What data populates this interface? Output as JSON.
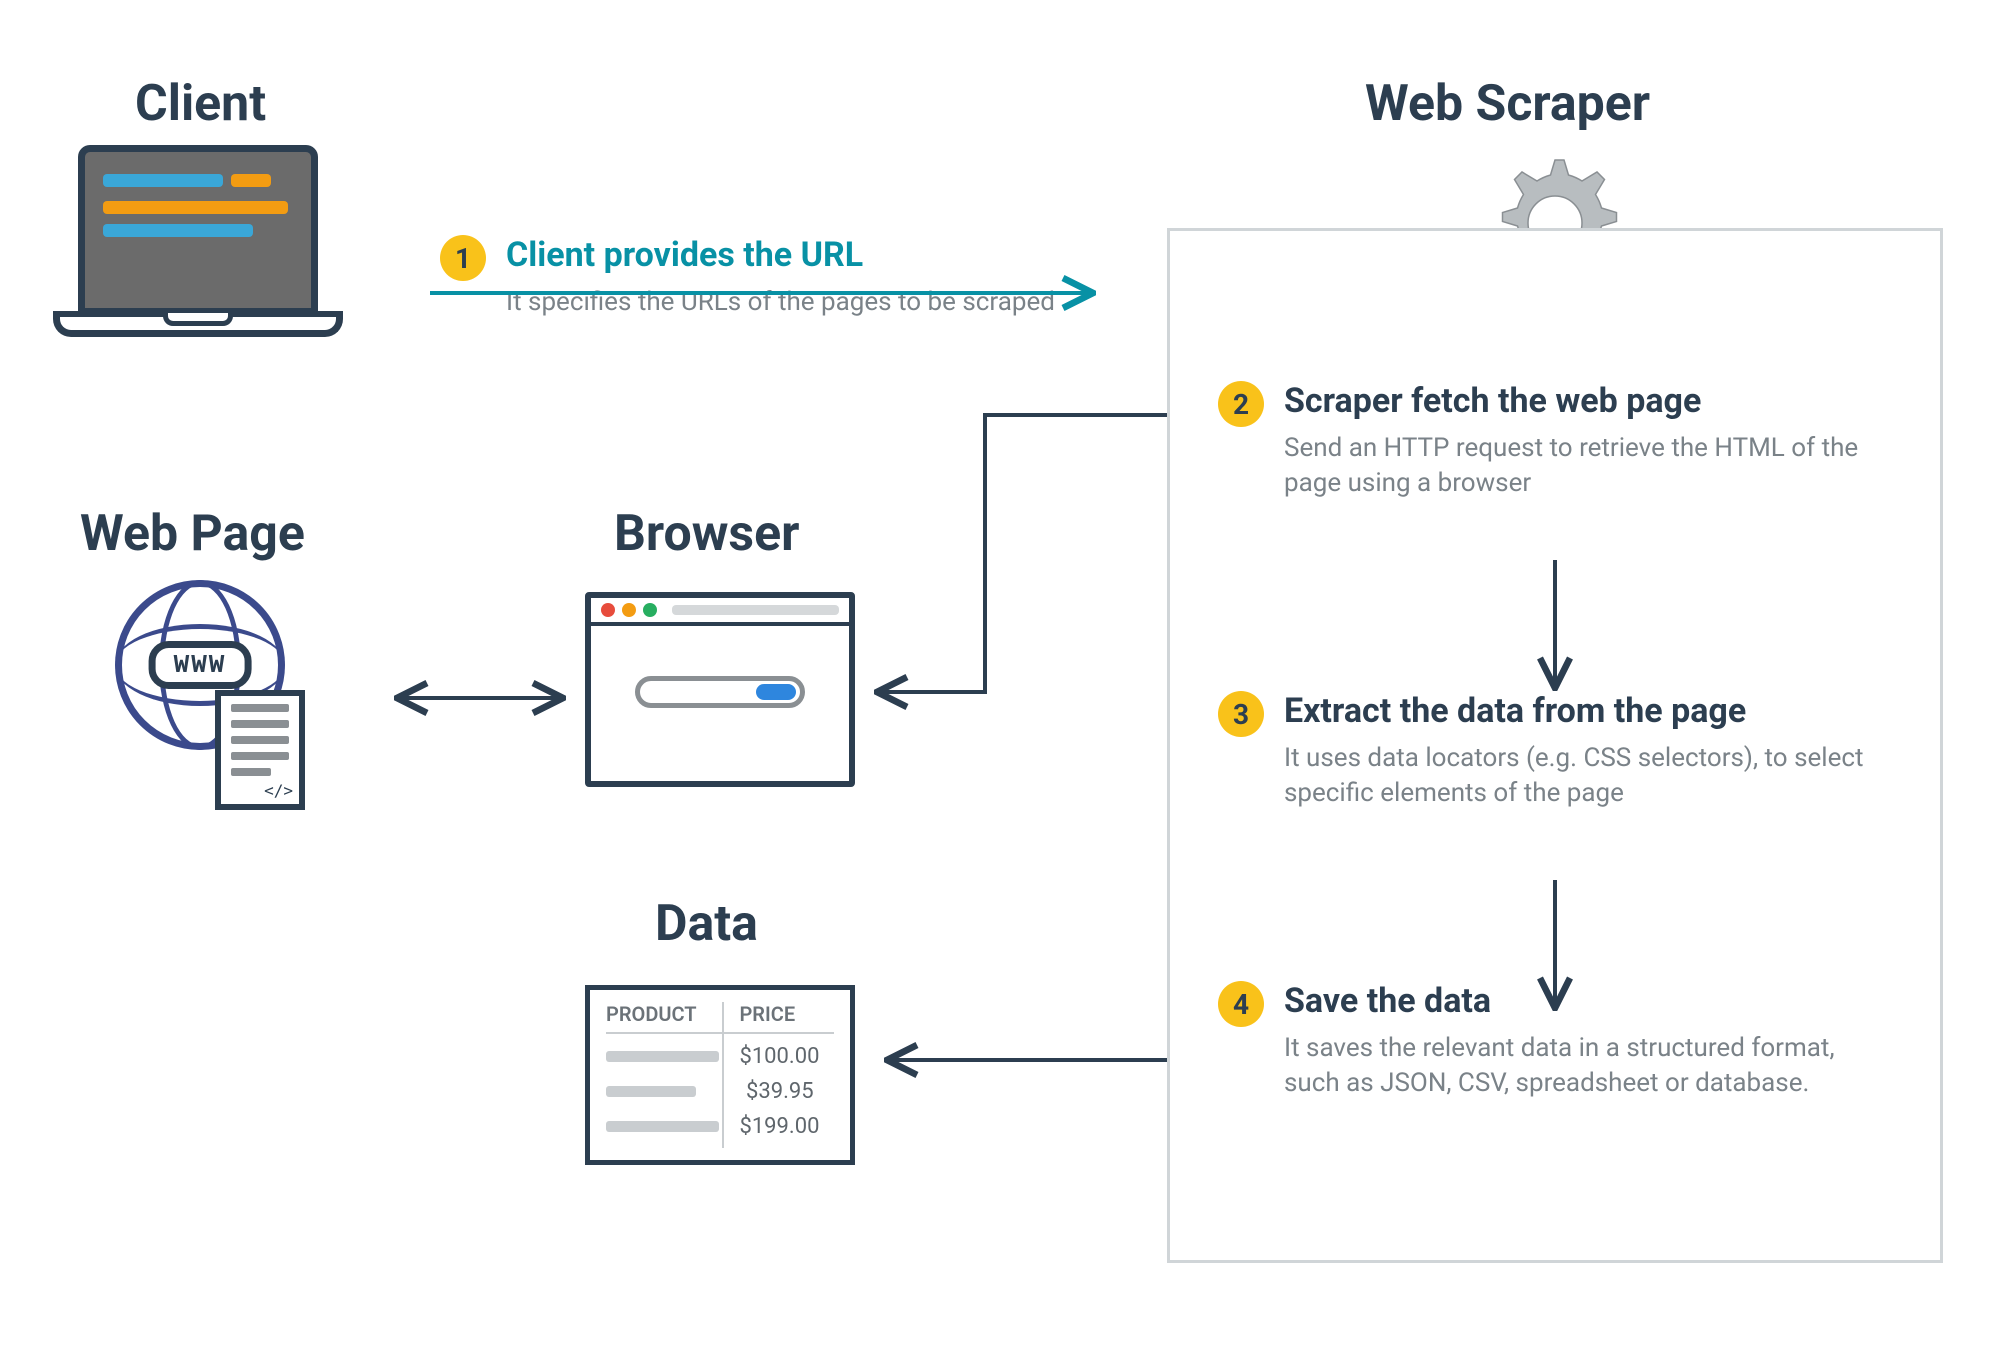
{
  "titles": {
    "client": "Client",
    "web_scraper": "Web Scraper",
    "web_page": "Web Page",
    "browser": "Browser",
    "data": "Data"
  },
  "steps": [
    {
      "num": "1",
      "title": "Client provides the URL",
      "desc": "It specifies the URLs of the pages to be scraped"
    },
    {
      "num": "2",
      "title": "Scraper fetch the web page",
      "desc": "Send an HTTP request to retrieve the HTML of the page using a browser"
    },
    {
      "num": "3",
      "title": "Extract the data from the page",
      "desc": "It uses data locators (e.g. CSS selectors), to select specific elements of the page"
    },
    {
      "num": "4",
      "title": "Save the data",
      "desc": "It saves the relevant data in a structured format, such as JSON, CSV, spreadsheet or database."
    }
  ],
  "www_label": "WWW",
  "doc_tag": "</>",
  "data_card": {
    "headers": [
      "PRODUCT",
      "PRICE"
    ],
    "prices": [
      "$100.00",
      "$39.95",
      "$199.00"
    ]
  },
  "colors": {
    "accent_yellow": "#F9C21A",
    "teal": "#0891A5",
    "dark": "#2C3E50",
    "muted": "#7A8288"
  }
}
